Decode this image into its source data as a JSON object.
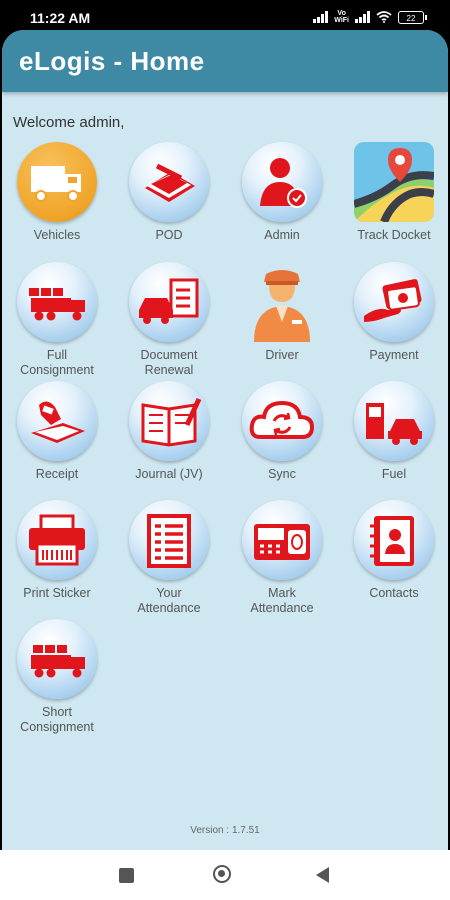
{
  "status_bar": {
    "time": "11:22 AM",
    "network_label": "Vo\nWiFi",
    "battery": "22"
  },
  "app": {
    "title": "eLogis - Home",
    "welcome": "Welcome admin,",
    "version": "Version : 1.7.51"
  },
  "colors": {
    "app_bar": "#3e89a3",
    "background": "#cfe7f1",
    "icon_red": "#e0161c",
    "vehicles_orange": "#f0a52a"
  },
  "tiles": [
    {
      "label": "Vehicles",
      "icon": "truck-icon"
    },
    {
      "label": "POD",
      "icon": "scanner-icon"
    },
    {
      "label": "Admin",
      "icon": "admin-user-icon"
    },
    {
      "label": "Track Docket",
      "icon": "map-pin-icon"
    },
    {
      "label": "Full\nConsignment",
      "icon": "loaded-truck-icon"
    },
    {
      "label": "Document\nRenewal",
      "icon": "car-clipboard-icon"
    },
    {
      "label": "Driver",
      "icon": "driver-icon"
    },
    {
      "label": "Payment",
      "icon": "cash-icon"
    },
    {
      "label": "Receipt",
      "icon": "receipt-icon"
    },
    {
      "label": "Journal (JV)",
      "icon": "journal-icon"
    },
    {
      "label": "Sync",
      "icon": "cloud-sync-icon"
    },
    {
      "label": "Fuel",
      "icon": "fuel-icon"
    },
    {
      "label": "Print Sticker",
      "icon": "printer-icon"
    },
    {
      "label": "Your\nAttendance",
      "icon": "attendance-list-icon"
    },
    {
      "label": "Mark\nAttendance",
      "icon": "biometric-device-icon"
    },
    {
      "label": "Contacts",
      "icon": "contacts-book-icon"
    },
    {
      "label": "Short\nConsignment",
      "icon": "short-truck-icon"
    }
  ]
}
